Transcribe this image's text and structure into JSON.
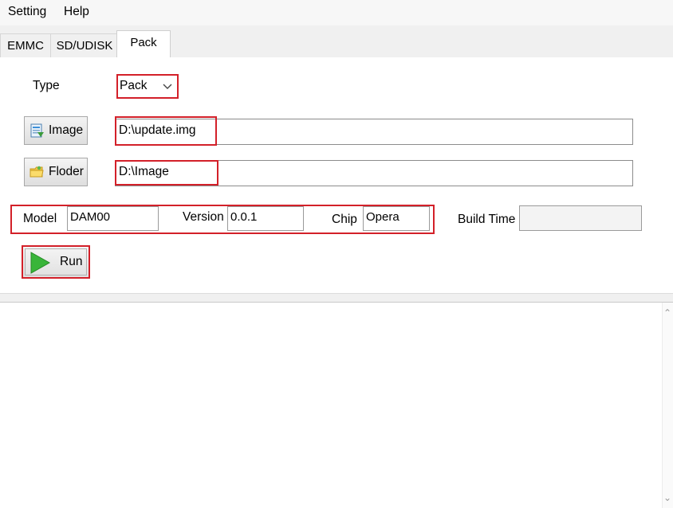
{
  "menu": [
    "Setting",
    "Help"
  ],
  "tabs": [
    {
      "label": "EMMC",
      "active": false
    },
    {
      "label": "SD/UDISK",
      "active": false
    },
    {
      "label": "Pack",
      "active": true
    }
  ],
  "type_field": {
    "label": "Type",
    "value": "Pack"
  },
  "image_field": {
    "button_label": "Image",
    "value": "D:\\update.img"
  },
  "folder_field": {
    "button_label": "Floder",
    "value": "D:\\Image"
  },
  "info": {
    "model_label": "Model",
    "model_value": "DAM00",
    "version_label": "Version",
    "version_value": "0.0.1",
    "chip_label": "Chip",
    "chip_value": "Opera",
    "build_time_label": "Build Time",
    "build_time_value": ""
  },
  "run_button": {
    "label": "Run"
  },
  "log_text": "",
  "colors": {
    "highlight": "#d32029",
    "run_icon": "#3cb83c"
  },
  "icons": {
    "image": "image-file-icon",
    "folder": "folder-icon",
    "run": "play-icon"
  }
}
